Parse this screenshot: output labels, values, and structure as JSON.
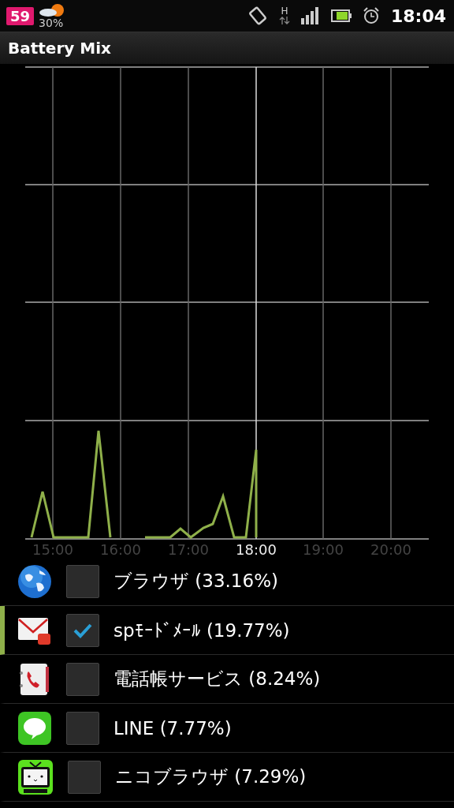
{
  "status_bar": {
    "badge": "59",
    "weather_temp": "30%",
    "network": "H",
    "time": "18:04"
  },
  "title": "Battery Mix",
  "chart": {
    "x_labels": [
      {
        "label": "15:00",
        "current": false
      },
      {
        "label": "16:00",
        "current": false
      },
      {
        "label": "17:00",
        "current": false
      },
      {
        "label": "18:00",
        "current": true
      },
      {
        "label": "19:00",
        "current": false
      },
      {
        "label": "20:00",
        "current": false
      }
    ]
  },
  "apps": [
    {
      "name": "ブラウザ (33.16%)",
      "checked": false,
      "selected": false
    },
    {
      "name": "spﾓｰﾄﾞﾒｰﾙ (19.77%)",
      "checked": true,
      "selected": true
    },
    {
      "name": "電話帳サービス (8.24%)",
      "checked": false,
      "selected": false
    },
    {
      "name": "LINE (7.77%)",
      "checked": false,
      "selected": false
    },
    {
      "name": "ニコブラウザ (7.29%)",
      "checked": false,
      "selected": false
    }
  ]
}
